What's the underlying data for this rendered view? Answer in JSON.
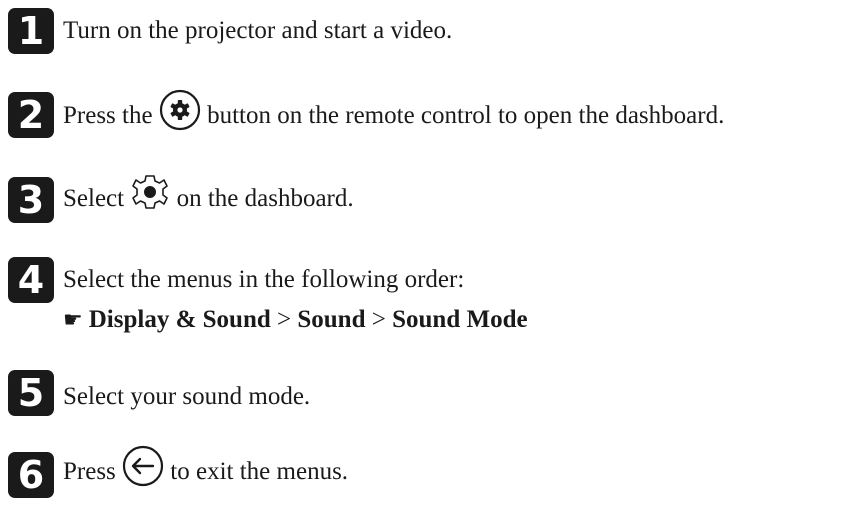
{
  "steps": [
    {
      "number": "1",
      "text": "Turn on the projector and start a video."
    },
    {
      "number": "2",
      "before": "Press the",
      "icon": "settings-gear-button-icon",
      "after": "button on the remote control to open the dashboard."
    },
    {
      "number": "3",
      "before": "Select",
      "icon": "settings-cog-icon",
      "after": "on the dashboard."
    },
    {
      "number": "4",
      "text": "Select the menus in the following order:",
      "path": {
        "pointer_icon": "pointing-hand-icon",
        "item1": "Display & Sound",
        "sep1": ">",
        "item2": "Sound",
        "sep2": ">",
        "item3": "Sound Mode"
      }
    },
    {
      "number": "5",
      "text": "Select your sound mode."
    },
    {
      "number": "6",
      "before": "Press",
      "icon": "back-arrow-button-icon",
      "after": "to exit the menus."
    }
  ]
}
